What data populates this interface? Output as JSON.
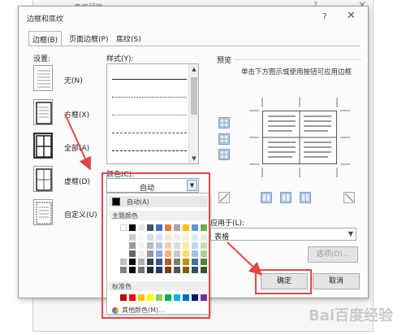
{
  "background_window": {
    "title": "表格属性",
    "help": "?",
    "close": "✕"
  },
  "dialog": {
    "title": "边框和底纹",
    "help_icon": "?",
    "close_icon": "✕",
    "tabs": [
      {
        "label": "边框(B)",
        "active": true
      },
      {
        "label": "页面边框(P)",
        "active": false
      },
      {
        "label": "底纹(S)",
        "active": false
      }
    ],
    "setting": {
      "label": "设置:",
      "options": [
        {
          "label": "无(N)",
          "selected": false
        },
        {
          "label": "方框(X)",
          "selected": false
        },
        {
          "label": "全部(A)",
          "selected": true
        },
        {
          "label": "虚框(D)",
          "selected": false
        },
        {
          "label": "自定义(U)",
          "selected": false
        }
      ]
    },
    "style": {
      "label": "样式(Y):"
    },
    "color": {
      "label": "颜色(C):",
      "value": "自动",
      "dropdown": {
        "auto_label": "自动(A)",
        "theme_header": "主题颜色",
        "standard_header": "标准色",
        "more_colors": "其他颜色(M)...",
        "theme_colors": [
          "#ffffff",
          "#000000",
          "#e7e6e6",
          "#44546a",
          "#4472c4",
          "#ed7d31",
          "#a5a5a5",
          "#ffc000",
          "#5b9bd5",
          "#70ad47"
        ],
        "standard_colors": [
          "#c00000",
          "#ff0000",
          "#ffc000",
          "#ffff00",
          "#92d050",
          "#00b050",
          "#00b0f0",
          "#0070c0",
          "#002060",
          "#7030a0"
        ]
      }
    },
    "preview": {
      "label": "预览",
      "hint": "单击下方图示或使用按钮可应用边框"
    },
    "apply_to": {
      "label": "应用于(L):",
      "value": "表格"
    },
    "buttons": {
      "options": "选项(O)...",
      "ok": "确定",
      "cancel": "取消"
    }
  },
  "watermark": "Bai百度经验"
}
